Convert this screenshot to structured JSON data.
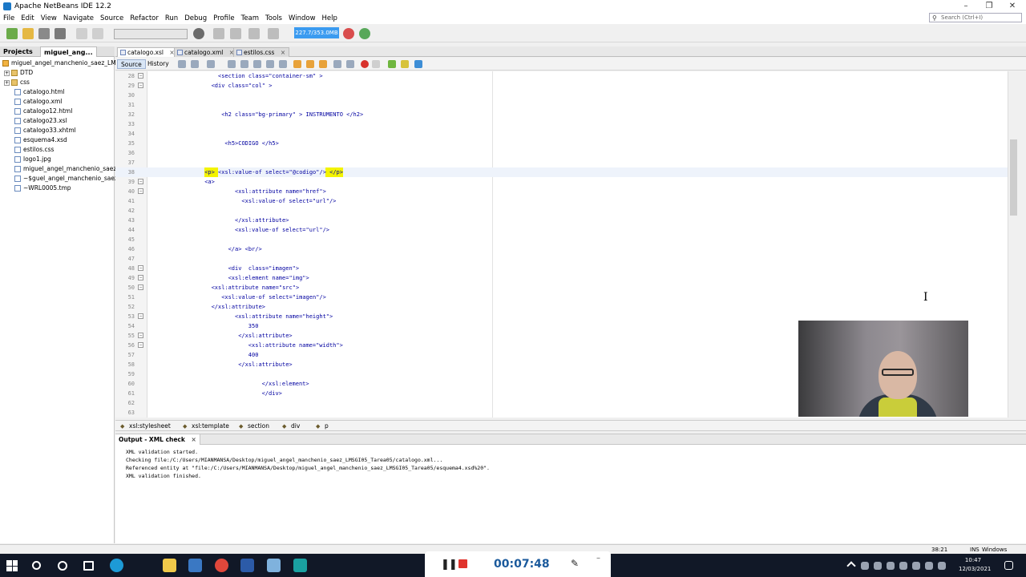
{
  "window": {
    "title": "Apache NetBeans IDE 12.2"
  },
  "menu": [
    "File",
    "Edit",
    "View",
    "Navigate",
    "Source",
    "Refactor",
    "Run",
    "Debug",
    "Profile",
    "Team",
    "Tools",
    "Window",
    "Help"
  ],
  "search": {
    "placeholder": "Search (Ctrl+I)"
  },
  "toolbar": {
    "memory": "227.7/353.0MB"
  },
  "left_panel": {
    "tabs": [
      "Projects",
      "miguel_ang..."
    ],
    "tree": [
      {
        "label": "miguel_angel_manchenio_saez_LMSGI",
        "type": "project"
      },
      {
        "label": "DTD",
        "type": "folder"
      },
      {
        "label": "css",
        "type": "folder"
      },
      {
        "label": "catalogo.html",
        "type": "file"
      },
      {
        "label": "catalogo.xml",
        "type": "file"
      },
      {
        "label": "catalogo12.html",
        "type": "file"
      },
      {
        "label": "catalogo23.xsl",
        "type": "file"
      },
      {
        "label": "catalogo33.xhtml",
        "type": "file"
      },
      {
        "label": "esquema4.xsd",
        "type": "file"
      },
      {
        "label": "estilos.css",
        "type": "file"
      },
      {
        "label": "logo1.jpg",
        "type": "file"
      },
      {
        "label": "miguel_angel_manchenio_saez_LM",
        "type": "file"
      },
      {
        "label": "~$guel_angel_manchenio_saez_LM",
        "type": "file"
      },
      {
        "label": "~WRL0005.tmp",
        "type": "file"
      }
    ]
  },
  "editor": {
    "tabs": [
      {
        "label": "catalogo.xsl",
        "active": true
      },
      {
        "label": "catalogo.xml",
        "active": false
      },
      {
        "label": "estilos.css",
        "active": false
      }
    ],
    "modes": {
      "source": "Source",
      "history": "History"
    },
    "lines": [
      {
        "n": "28",
        "fold": true,
        "indent": 20,
        "text": "<section class=\"container-sm\" >"
      },
      {
        "n": "29",
        "fold": true,
        "indent": 18,
        "text": "<div class=\"col\" >"
      },
      {
        "n": "30",
        "indent": 0,
        "text": ""
      },
      {
        "n": "31",
        "indent": 0,
        "text": ""
      },
      {
        "n": "32",
        "indent": 21,
        "text": "<h2 class=\"bg-primary\" > INSTRUMENTO </h2>"
      },
      {
        "n": "33",
        "indent": 0,
        "text": ""
      },
      {
        "n": "34",
        "indent": 0,
        "text": ""
      },
      {
        "n": "35",
        "indent": 22,
        "text": "<h5>CODIGO </h5>"
      },
      {
        "n": "36",
        "indent": 0,
        "text": ""
      },
      {
        "n": "37",
        "indent": 0,
        "text": ""
      },
      {
        "n": "38",
        "indent": 16,
        "text": "<p> <xsl:value-of select=\"@codigo\"/> </p>",
        "current": true
      },
      {
        "n": "39",
        "fold": true,
        "indent": 16,
        "text": "<a>"
      },
      {
        "n": "40",
        "fold": true,
        "indent": 25,
        "text": "<xsl:attribute name=\"href\">"
      },
      {
        "n": "41",
        "indent": 27,
        "text": "<xsl:value-of select=\"url\"/>"
      },
      {
        "n": "42",
        "indent": 0,
        "text": ""
      },
      {
        "n": "43",
        "indent": 25,
        "text": "</xsl:attribute>"
      },
      {
        "n": "44",
        "indent": 25,
        "text": "<xsl:value-of select=\"url\"/>"
      },
      {
        "n": "45",
        "indent": 0,
        "text": ""
      },
      {
        "n": "46",
        "indent": 23,
        "text": "</a> <br/>"
      },
      {
        "n": "47",
        "indent": 0,
        "text": ""
      },
      {
        "n": "48",
        "fold": true,
        "indent": 23,
        "text": "<div  class=\"imagen\">"
      },
      {
        "n": "49",
        "fold": true,
        "indent": 23,
        "text": "<xsl:element name=\"img\">"
      },
      {
        "n": "50",
        "fold": true,
        "indent": 18,
        "text": "<xsl:attribute name=\"src\">"
      },
      {
        "n": "51",
        "indent": 21,
        "text": "<xsl:value-of select=\"imagen\"/>"
      },
      {
        "n": "52",
        "indent": 18,
        "text": "</xsl:attribute>"
      },
      {
        "n": "53",
        "fold": true,
        "indent": 25,
        "text": "<xsl:attribute name=\"height\">"
      },
      {
        "n": "54",
        "indent": 29,
        "text": "350"
      },
      {
        "n": "55",
        "fold": true,
        "indent": 26,
        "text": "</xsl:attribute>"
      },
      {
        "n": "56",
        "fold": true,
        "indent": 29,
        "text": "<xsl:attribute name=\"width\">"
      },
      {
        "n": "57",
        "indent": 29,
        "text": "400"
      },
      {
        "n": "58",
        "indent": 26,
        "text": "</xsl:attribute>"
      },
      {
        "n": "59",
        "indent": 0,
        "text": ""
      },
      {
        "n": "60",
        "indent": 33,
        "text": "</xsl:element>"
      },
      {
        "n": "61",
        "indent": 33,
        "text": "</div>"
      },
      {
        "n": "62",
        "indent": 0,
        "text": ""
      },
      {
        "n": "63",
        "indent": 0,
        "text": ""
      }
    ]
  },
  "breadcrumbs": [
    "xsl:stylesheet",
    "xsl:template",
    "section",
    "div",
    "p"
  ],
  "output": {
    "tab": "Output - XML check",
    "lines": [
      "XML validation started.",
      "Checking file:/C:/Users/MIANMANSA/Desktop/miguel_angel_manchenio_saez_LMSGI05_Tarea05/catalogo.xml...",
      "Referenced entity at \"file:/C:/Users/MIANMANSA/Desktop/miguel_angel_manchenio_saez_LMSGI05_Tarea05/esquema4.xsd%20\".",
      "XML validation finished."
    ]
  },
  "status": {
    "position": "38:21",
    "mode": "INS",
    "line_ending": "Windows (CRLF)"
  },
  "recorder": {
    "time": "00:07:48"
  },
  "clock": {
    "time": "10:47",
    "date": "12/03/2021"
  }
}
